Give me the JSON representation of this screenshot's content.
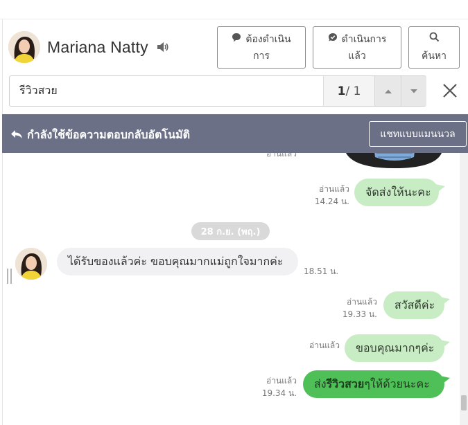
{
  "contact": {
    "name": "Mariana Natty"
  },
  "header_buttons": {
    "todo_line1": "ต้องดำเนิน",
    "todo_line2": "การ",
    "done_line1": "ดำเนินการ",
    "done_line2": "แล้ว",
    "search_label": "ค้นหา"
  },
  "search": {
    "query": "รีวิวสวย",
    "current": "1",
    "total": "/ 1"
  },
  "banner": {
    "text": "กำลังใช้ข้อความตอบกลับอัตโนมัติ",
    "manual_button": "แชทแบบแมนนวล"
  },
  "chat": {
    "partial_read": "อ่านแล้ว",
    "date_separator": "28 ก.ย. (พฤ.)",
    "messages": [
      {
        "direction": "out",
        "text": "จัดส่งให้นะคะ",
        "read": "อ่านแล้ว",
        "time": "14.24 น."
      },
      {
        "direction": "in",
        "text": "ได้รับของแล้วค่ะ ขอบคุณมากแม่ถูกใจมากค่ะ",
        "time": "18.51 น."
      },
      {
        "direction": "out",
        "text": "สวัสดีค่ะ",
        "read": "อ่านแล้ว",
        "time": "19.33 น."
      },
      {
        "direction": "out",
        "text": "ขอบคุณมากๆค่ะ",
        "read": "อ่านแล้ว",
        "time": ""
      },
      {
        "direction": "out",
        "text_before": "ส่ง",
        "text_highlight": "รีวิวสวย",
        "text_after": "ๆให้ด้วยนะคะ",
        "read": "อ่านแล้ว",
        "time": "19.34 น."
      }
    ]
  },
  "icons": {
    "speaker": "speaker-icon",
    "todo": "speech-bubble-icon",
    "done": "check-bubble-icon",
    "search": "search-icon",
    "up": "chevron-up-icon",
    "down": "chevron-down-icon",
    "close": "close-icon",
    "reply": "reply-icon"
  },
  "colors": {
    "banner_bg": "#6b7087",
    "bubble_out": "#c8ecc3",
    "bubble_out_highlight": "#4fbf57",
    "bubble_in": "#f1f1f3",
    "date_pill": "#d9d9d9"
  }
}
